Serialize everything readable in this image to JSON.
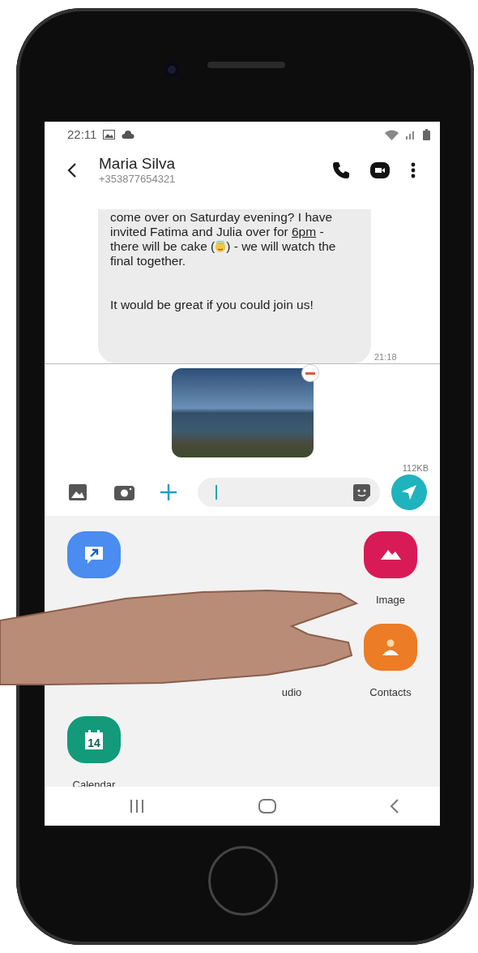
{
  "status_bar": {
    "time": "22:11"
  },
  "conversation": {
    "name": "Maria Silva",
    "number": "+353877654321"
  },
  "message": {
    "text_before": "come over on Saturday evening? I have invited Fatima and Julia over for ",
    "link": "6pm",
    "text_mid": " - there will be cake (",
    "text_after": ") - we will watch the final together.",
    "closing": "It would be great if you could join us!",
    "time": "21:18"
  },
  "attachment": {
    "size": "112KB"
  },
  "attach_options": [
    {
      "kind": "share"
    },
    {
      "kind": "covered"
    },
    {
      "kind": "covered"
    },
    {
      "kind": "image",
      "label": "Image"
    },
    {
      "kind": "covered"
    },
    {
      "kind": "covered"
    },
    {
      "kind": "audio",
      "label": "udio"
    },
    {
      "kind": "contacts",
      "label": "Contacts"
    },
    {
      "kind": "calendar",
      "label": "Calendar",
      "day": "14"
    }
  ]
}
